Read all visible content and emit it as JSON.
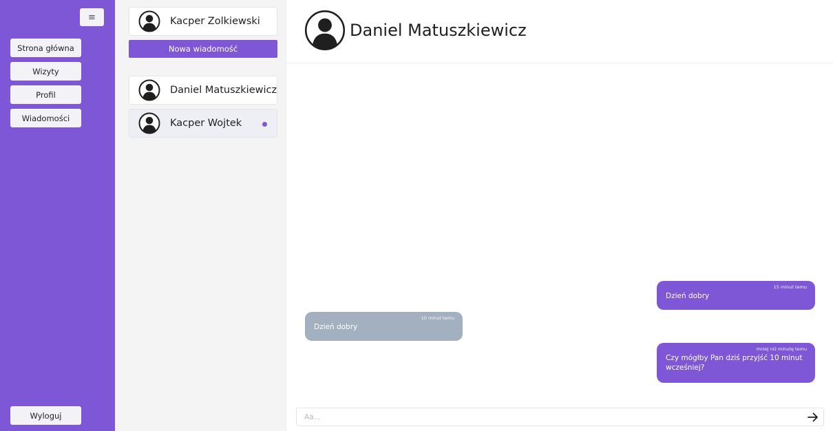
{
  "sidebar": {
    "menu_icon": "hamburger-icon",
    "items": [
      {
        "label": "Strona główna"
      },
      {
        "label": "Wizyty"
      },
      {
        "label": "Profil"
      },
      {
        "label": "Wiadomości"
      }
    ],
    "logout_label": "Wyloguj"
  },
  "conversations": {
    "current_user": "Kacper Zolkiewski",
    "new_message_label": "Nowa wiadomość",
    "items": [
      {
        "name": "Daniel Matuszkiewicz",
        "unread": false
      },
      {
        "name": "Kacper Wojtek",
        "unread": true
      }
    ]
  },
  "chat": {
    "title": "Daniel Matuszkiewicz",
    "messages": [
      {
        "direction": "out",
        "time": "15 minut temu",
        "text": "Dzień dobry"
      },
      {
        "direction": "in",
        "time": "10 minut temu",
        "text": "Dzień dobry"
      },
      {
        "direction": "out",
        "time": "mniej niż minutę temu",
        "text": "Czy mógłby Pan dziś przyjść 10 minut wcześniej?"
      }
    ],
    "input_placeholder": "Aa...",
    "input_value": "",
    "send_icon": "arrow-right-icon"
  },
  "colors": {
    "accent": "#7e57d7",
    "incoming_bubble": "#a2b0c0",
    "panel_bg": "#f4f4f4"
  }
}
